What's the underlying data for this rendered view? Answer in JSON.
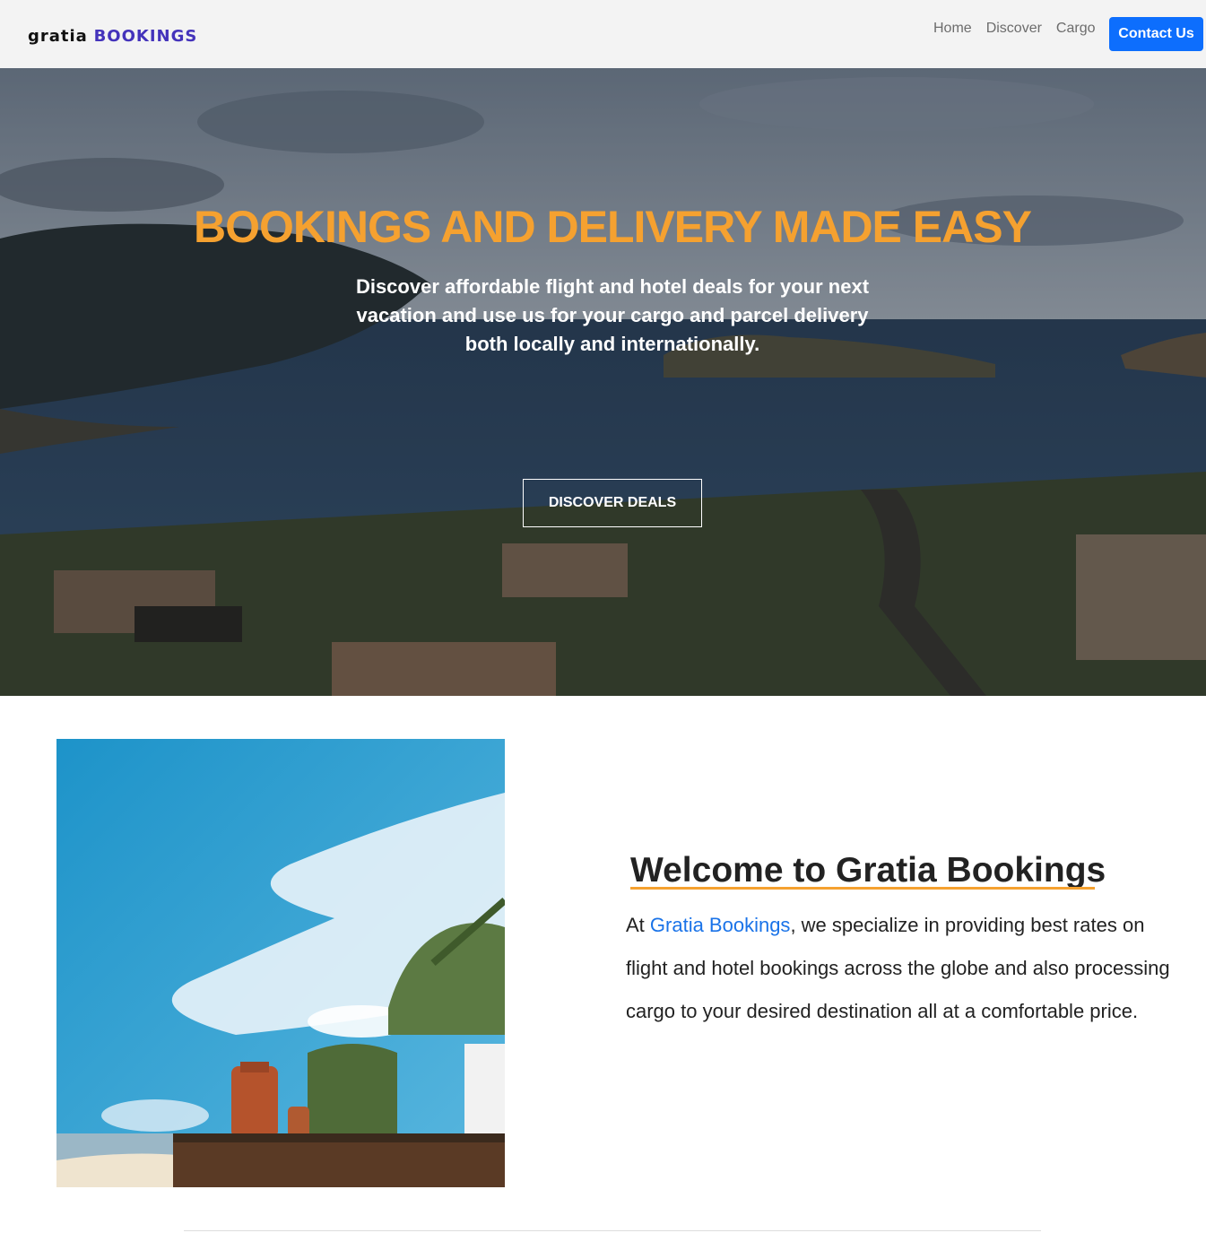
{
  "navbar": {
    "brand_first": "gratia",
    "brand_second": "BOOKINGS",
    "links": [
      "Home",
      "Discover",
      "Cargo"
    ],
    "contact_label": "Contact Us"
  },
  "hero": {
    "title": "BOOKINGS AND DELIVERY MADE EASY",
    "subtitle": "Discover affordable flight and hotel deals for your next vacation and use us for your cargo and parcel delivery both locally and internationally.",
    "button_label": "DISCOVER DEALS"
  },
  "welcome": {
    "title": "Welcome to Gratia Bookings",
    "text_prefix": "At ",
    "brand_link": "Gratia Bookings",
    "text_suffix": ", we specialize in providing best rates on flight and hotel bookings across the globe and also processing cargo to your desired destination all at a comfortable price."
  },
  "colors": {
    "accent": "#f5a130",
    "brand": "#4433bb",
    "button": "#0d6efd",
    "link": "#1a73e8"
  }
}
